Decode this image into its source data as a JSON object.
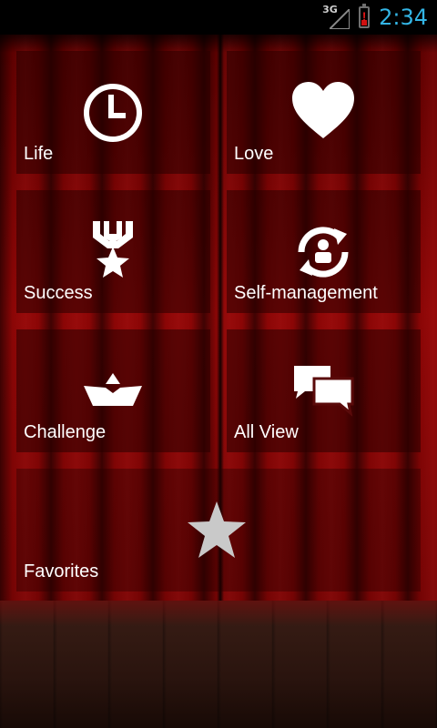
{
  "status_bar": {
    "network": "3G",
    "time": "2:34"
  },
  "menu": {
    "tiles": [
      {
        "label": "Life",
        "icon": "clock-icon"
      },
      {
        "label": "Love",
        "icon": "heart-icon"
      },
      {
        "label": "Success",
        "icon": "medal-icon"
      },
      {
        "label": "Self-management",
        "icon": "person-refresh-icon"
      },
      {
        "label": "Challenge",
        "icon": "boat-icon"
      },
      {
        "label": "All View",
        "icon": "chat-bubbles-icon"
      },
      {
        "label": "Favorites",
        "icon": "star-icon"
      }
    ]
  },
  "colors": {
    "clock": "#33b5e5",
    "curtain": "#8c0606",
    "floor": "#2a140e",
    "icon": "#ffffff",
    "favorites_icon": "#c9c9c9"
  }
}
